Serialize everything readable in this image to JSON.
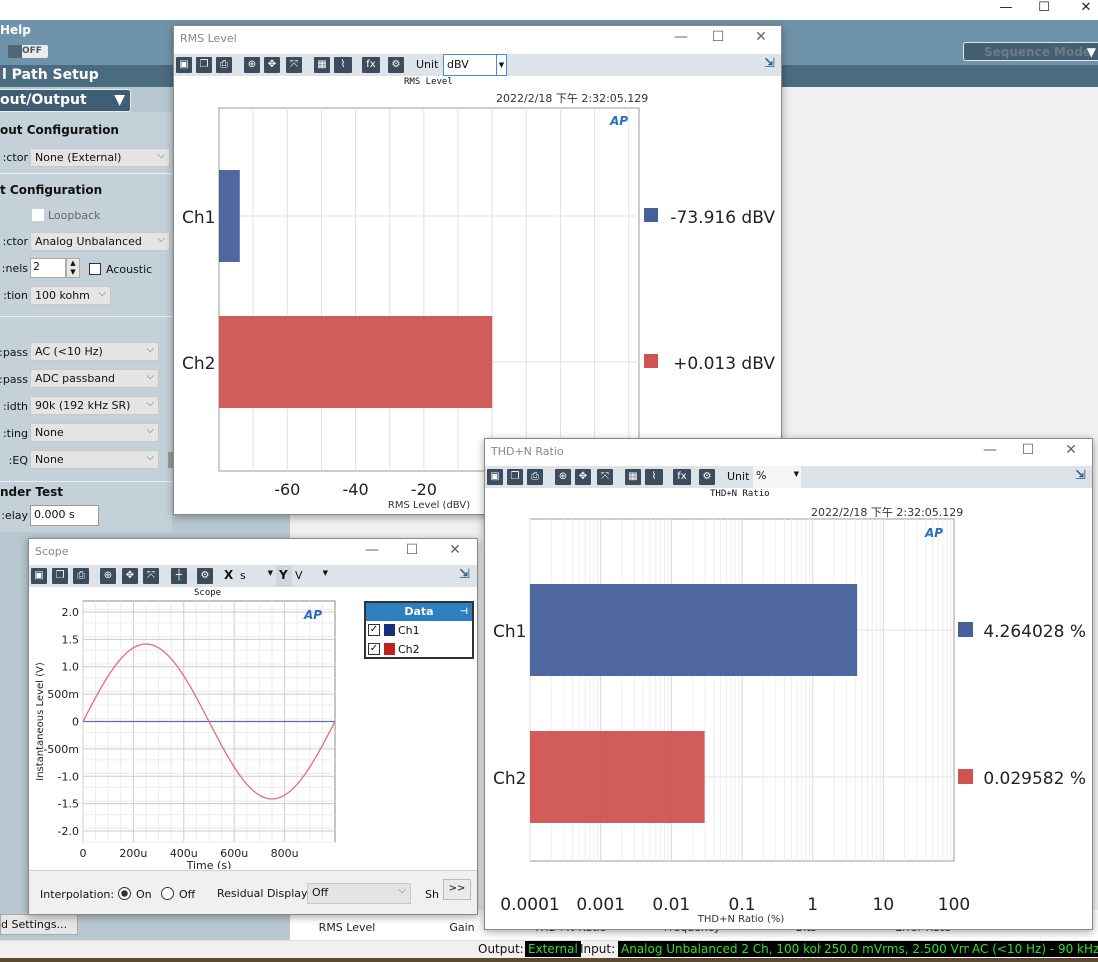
{
  "app": {
    "menu_help": "Help",
    "toggle_label": "OFF",
    "panel_title": "l Path Setup",
    "panel_dropdown": "out/Output",
    "sequence_mode": "Sequence Mode",
    "window_controls": [
      "—",
      "☐",
      "✕"
    ]
  },
  "left_panel": {
    "output_config_title": "out Configuration",
    "output_connector_label": "ctor:",
    "output_connector_value": "None (External)",
    "input_config_title": "t Configuration",
    "loopback_label": "Loopback",
    "input_connector_label": "ctor:",
    "input_connector_value": "Analog Unbalanced",
    "channels_label": "nels:",
    "channels_value": "2",
    "acoustic_label": "Acoustic",
    "termination_label": "tion:",
    "termination_value": "100 kohm",
    "highpass_label": "pass:",
    "highpass_value": "AC (<10 Hz)",
    "lowpass_label": "pass:",
    "lowpass_value": "ADC passband",
    "bandwidth_label": "idth:",
    "bandwidth_value": "90k (192 kHz SR)",
    "weighting_label": "ting:",
    "weighting_value": "None",
    "eq_label": "EQ:",
    "eq_value": "None",
    "dut_title": "nder Test",
    "delay_label": "elay:",
    "delay_value": "0.000 s",
    "advanced_button": "d Settings..."
  },
  "bottom_tabs": [
    "RMS Level",
    "Gain",
    "THD+N Ratio",
    "Frequency",
    "Bits",
    "Error Rate"
  ],
  "status": {
    "output_label": "Output:",
    "output_value": "External",
    "input_label": "Input:",
    "input_value": "Analog Unbalanced 2 Ch, 100 kohm",
    "range_value": "250.0 mVrms, 2.500 Vrms",
    "filter_value": "AC (<10 Hz) - 90 kHz",
    "text_color": "#2fe02f"
  },
  "rms_window": {
    "title": "RMS Level",
    "unit_label": "Unit",
    "unit_value": "dBV",
    "timestamp": "2022/2/18 下午 2:32:05.129",
    "toolbar_icons": [
      "save-icon",
      "copy-icon",
      "print-icon",
      "zoom-icon",
      "pan-icon",
      "fit-icon",
      "table-icon",
      "graph-icon",
      "fx-icon",
      "settings-icon"
    ],
    "values": [
      "-73.916 dBV",
      "+0.013 dBV"
    ]
  },
  "thd_window": {
    "title": "THD+N Ratio",
    "unit_label": "Unit",
    "unit_value": "%",
    "timestamp": "2022/2/18 下午 2:32:05.129",
    "values": [
      "4.264028 %",
      "0.029582 %"
    ]
  },
  "scope_window": {
    "title": "Scope",
    "x_label": "X",
    "x_unit": "s",
    "y_label": "Y",
    "y_unit": "V",
    "legend_title": "Data",
    "interpolation_label": "Interpolation:",
    "interp_on": "On",
    "interp_off": "Off",
    "interp_selected": "On",
    "residual_label": "Residual Display:",
    "residual_value": "Off",
    "show_label": "Sh",
    "expand_button": ">>"
  },
  "chart_data": [
    {
      "type": "bar",
      "orientation": "horizontal",
      "title": "RMS Level",
      "categories": [
        "Ch1",
        "Ch2"
      ],
      "values": [
        -73.916,
        0.013
      ],
      "colors": [
        "#46609a",
        "#d05350"
      ],
      "xlabel": "RMS Level (dBV)",
      "xlim": [
        -80,
        43
      ],
      "xticks": [
        -60,
        -40,
        -20
      ],
      "grid": true
    },
    {
      "type": "bar",
      "orientation": "horizontal",
      "title": "THD+N Ratio",
      "categories": [
        "Ch1",
        "Ch2"
      ],
      "values": [
        4.264028,
        0.029582
      ],
      "colors": [
        "#46609a",
        "#d05350"
      ],
      "xlabel": "THD+N Ratio (%)",
      "xscale": "log",
      "xlim": [
        0.0001,
        100
      ],
      "xticks": [
        "0.0001",
        "0.001",
        "0.01",
        "0.1",
        "1",
        "10",
        "100"
      ],
      "grid": true
    },
    {
      "type": "line",
      "title": "Scope",
      "xlabel": "Time (s)",
      "ylabel": "Instantaneous Level (V)",
      "xlim": [
        0,
        0.001
      ],
      "ylim": [
        -2.2,
        2.2
      ],
      "xticks": [
        [
          "0",
          0
        ],
        [
          "200u",
          0.0002
        ],
        [
          "400u",
          0.0004
        ],
        [
          "600u",
          0.0006
        ],
        [
          "800u",
          0.0008
        ]
      ],
      "yticks": [
        [
          "2.0",
          2
        ],
        [
          "1.5",
          1.5
        ],
        [
          "1.0",
          1
        ],
        [
          "500m",
          0.5
        ],
        [
          "0",
          0
        ],
        [
          "-500m",
          -0.5
        ],
        [
          "-1.0",
          -1
        ],
        [
          "-1.5",
          -1.5
        ],
        [
          "-2.0",
          -2
        ]
      ],
      "series": [
        {
          "name": "Ch1",
          "color": "#1a2f7a",
          "line_color": "#5a6fa8",
          "amplitude": 0,
          "frequency_hz": 1000
        },
        {
          "name": "Ch2",
          "color": "#c42020",
          "line_color": "#e07070",
          "amplitude": 1.414,
          "frequency_hz": 1000
        }
      ],
      "grid": true
    }
  ]
}
